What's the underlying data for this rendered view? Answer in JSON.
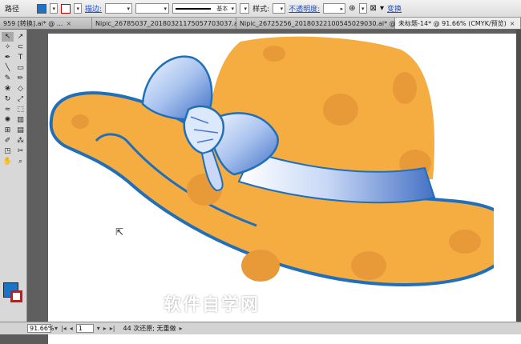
{
  "control_bar": {
    "path_label": "路径",
    "stroke_label": "描边:",
    "stroke_style": "基本",
    "style_label": "样式:",
    "opacity_label": "不透明度:",
    "transform_label": "变换",
    "accent_fill": "#1a73c8"
  },
  "tabs": [
    {
      "label": "959 [转换].ai* @ ..."
    },
    {
      "label": "Nipic_26785037_20180321175057703037.ai* @ ..."
    },
    {
      "label": "Nipic_26725256_20180322100545029030.ai* @ ..."
    },
    {
      "label": "未标题-14* @ 91.66% (CMYK/预览)"
    }
  ],
  "tools": {
    "icons": [
      "selection-icon",
      "direct-selection-icon",
      "magic-wand-icon",
      "lasso-icon",
      "pen-icon",
      "type-icon",
      "line-icon",
      "rectangle-icon",
      "paintbrush-icon",
      "pencil-icon",
      "blob-brush-icon",
      "eraser-icon",
      "rotate-icon",
      "scale-icon",
      "warp-icon",
      "free-transform-icon",
      "symbol-sprayer-icon",
      "graph-icon",
      "mesh-icon",
      "gradient-icon",
      "eyedropper-icon",
      "blend-icon",
      "slice-icon",
      "scissors-icon",
      "hand-icon",
      "zoom-icon"
    ],
    "glyphs": [
      "↖",
      "↗",
      "✧",
      "⊂",
      "✒",
      "T",
      "╲",
      "▭",
      "✎",
      "✏",
      "❀",
      "◇",
      "↻",
      "⤢",
      "≈",
      "⬚",
      "✺",
      "▥",
      "⊞",
      "▤",
      "✐",
      "⁂",
      "◳",
      "✂",
      "✋",
      "⌕"
    ],
    "fill_color": "#1875c8",
    "stroke_color": "#e01010"
  },
  "canvas": {
    "hat_fill": "#f5ad42",
    "hat_spot": "#e89a38",
    "hat_outline": "#1f6fba",
    "bow_light": "#dce8fb",
    "bow_dark": "#4a78cc",
    "watermark": "软件自学网",
    "watermark_sub": "RJZXW.COM"
  },
  "status_bar": {
    "zoom": "91.66%",
    "page": "1",
    "status_text": "44 次还原; 无重做"
  }
}
